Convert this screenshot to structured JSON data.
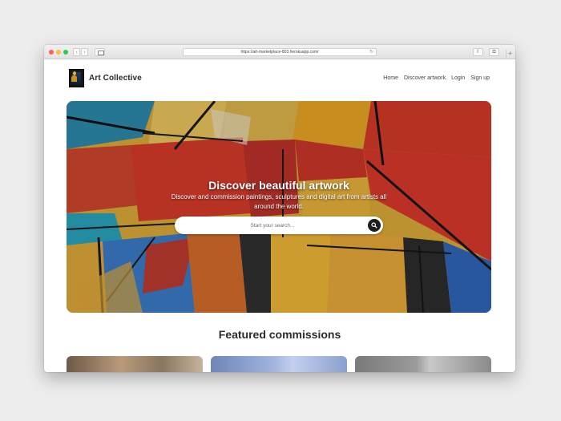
{
  "browser": {
    "url": "https://art-marketplace-803.herokuapp.com/"
  },
  "header": {
    "brand": "Art Collective",
    "nav": [
      "Home",
      "Discover artwork",
      "Login",
      "Sign up"
    ]
  },
  "hero": {
    "title": "Discover beautiful artwork",
    "subtitle": "Discover and commission paintings, sculptures and digital art from artists all around the world.",
    "search_placeholder": "Start your search..."
  },
  "featured": {
    "title": "Featured commissions"
  },
  "icons": {
    "logo": "mona-lisa-logo-icon",
    "search": "search-icon",
    "reload": "reload-icon",
    "share": "share-icon",
    "tabs": "tabs-icon"
  },
  "colors": {
    "accent_dark": "#1d1d1d",
    "hero_red": "#d32f24",
    "hero_yellow": "#e0a92a",
    "hero_blue": "#2f6fb7"
  }
}
